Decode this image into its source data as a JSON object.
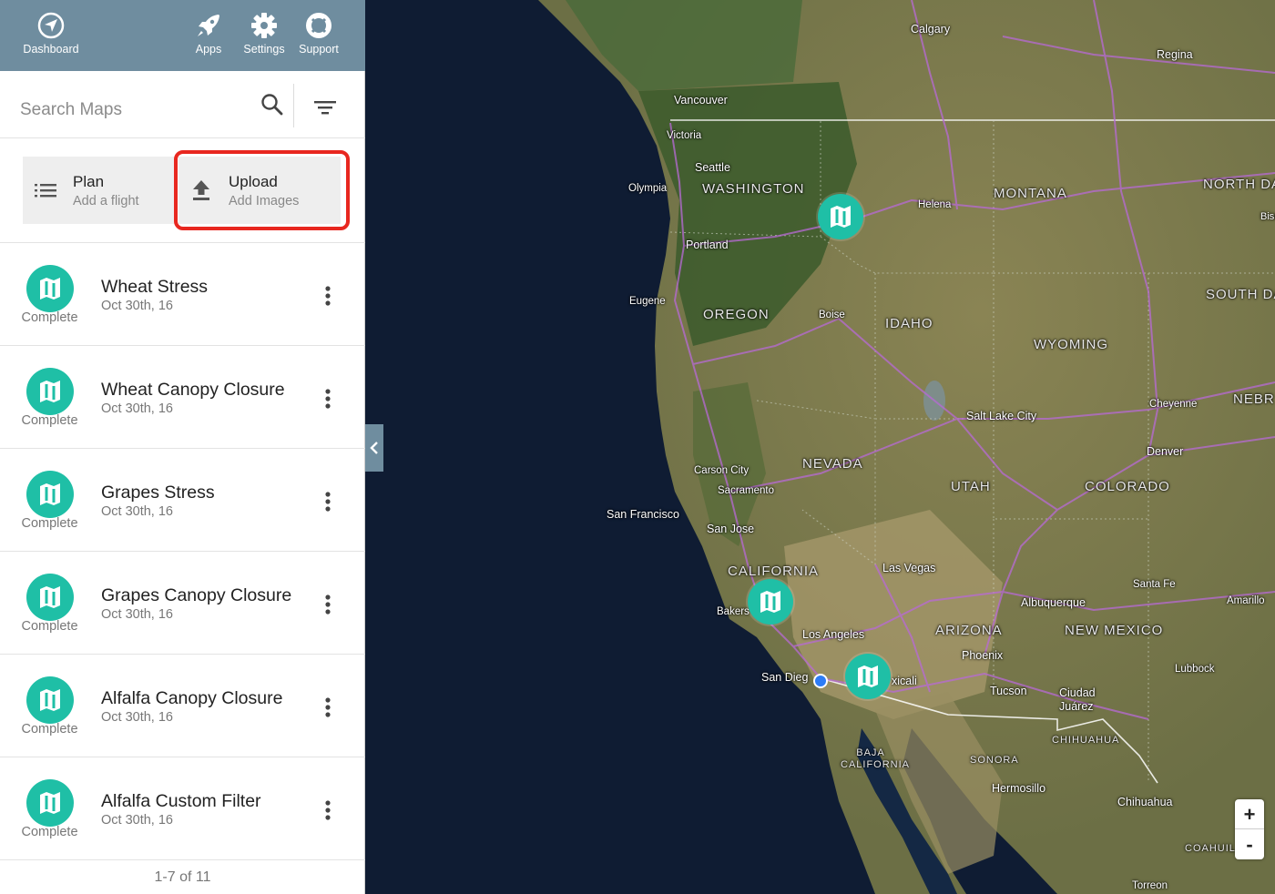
{
  "nav": {
    "dashboard": "Dashboard",
    "apps": "Apps",
    "settings": "Settings",
    "support": "Support"
  },
  "search": {
    "placeholder": "Search Maps"
  },
  "actions": {
    "plan": {
      "title": "Plan",
      "subtitle": "Add a flight"
    },
    "upload": {
      "title": "Upload",
      "subtitle": "Add Images"
    }
  },
  "maps": [
    {
      "title": "Wheat Stress",
      "date": "Oct 30th, 16",
      "status": "Complete"
    },
    {
      "title": "Wheat Canopy Closure",
      "date": "Oct 30th, 16",
      "status": "Complete"
    },
    {
      "title": "Grapes Stress",
      "date": "Oct 30th, 16",
      "status": "Complete"
    },
    {
      "title": "Grapes Canopy Closure",
      "date": "Oct 30th, 16",
      "status": "Complete"
    },
    {
      "title": "Alfalfa Canopy Closure",
      "date": "Oct 30th, 16",
      "status": "Complete"
    },
    {
      "title": "Alfalfa Custom Filter",
      "date": "Oct 30th, 16",
      "status": "Complete"
    }
  ],
  "pagination": "1-7 of 11",
  "map": {
    "cities": [
      "Calgary",
      "Regina",
      "Vancouver",
      "Victoria",
      "Seattle",
      "Olympia",
      "Helena",
      "Bisr",
      "Portland",
      "Eugene",
      "Boise",
      "Salt Lake City",
      "Cheyenne",
      "Denver",
      "Carson City",
      "Sacramento",
      "San Francisco",
      "San Jose",
      "Las Vegas",
      "Santa Fe",
      "Amarillo",
      "Albuquerque",
      "Bakers",
      "Los Angeles",
      "Phoenix",
      "San Dieg",
      "xicali",
      "Lubbock",
      "Tucson",
      "Ciudad Juárez",
      "Hermosillo",
      "Chihuahua",
      "Torreon"
    ],
    "states": [
      "WASHINGTON",
      "MONTANA",
      "NORTH DA",
      "OREGON",
      "IDAHO",
      "SOUTH DA",
      "WYOMING",
      "NEBR",
      "NEVADA",
      "UTAH",
      "COLORADO",
      "CALIFORNIA",
      "ARIZONA",
      "NEW MEXICO",
      "CHIHUAHUA",
      "BAJA CALIFORNIA",
      "SONORA",
      "COAHUIL"
    ],
    "zoom_in": "+",
    "zoom_out": "-"
  },
  "colors": {
    "accent": "#1fbfa6",
    "nav_bg": "#6f8d9f",
    "highlight": "#e8271f",
    "location": "#2d7cf6"
  },
  "icons": {
    "nav": [
      "compass-icon",
      "rocket-icon",
      "gear-icon",
      "lifebuoy-icon"
    ],
    "map_badge": "map-icon"
  }
}
